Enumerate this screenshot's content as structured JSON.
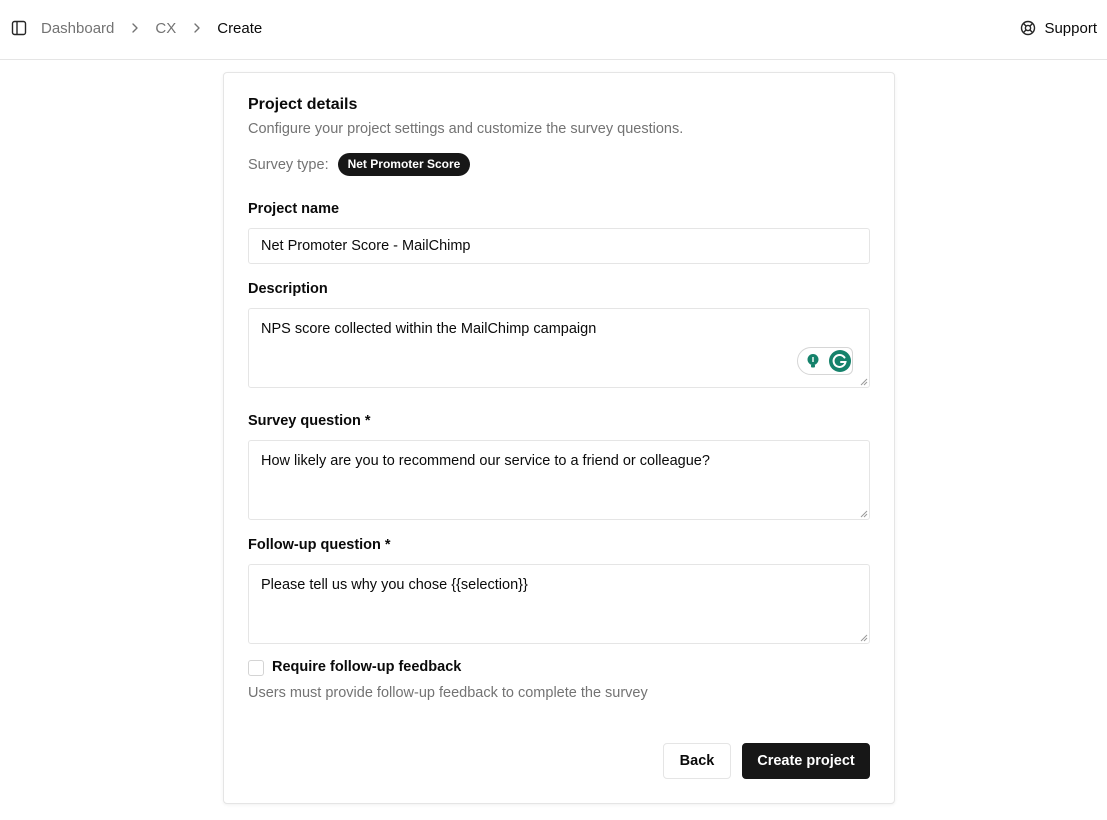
{
  "header": {
    "sidebar_toggle_icon": "panel-left-icon",
    "breadcrumb": [
      "Dashboard",
      "CX",
      "Create"
    ],
    "support_label": "Support",
    "support_icon": "life-buoy-icon"
  },
  "card": {
    "title": "Project details",
    "description": "Configure your project settings and customize the survey questions.",
    "survey_type_label": "Survey type:",
    "survey_type_value": "Net Promoter Score",
    "project_name": {
      "label": "Project name",
      "value": "Net Promoter Score - MailChimp"
    },
    "description_field": {
      "label": "Description",
      "value": "NPS score collected within the MailChimp campaign"
    },
    "survey_question": {
      "label": "Survey question *",
      "value": "How likely are you to recommend our service to a friend or colleague?"
    },
    "followup_question": {
      "label": "Follow-up question *",
      "value": "Please tell us why you chose {{selection}}"
    },
    "require_followup": {
      "label": "Require follow-up feedback",
      "checked": false,
      "help": "Users must provide follow-up feedback to complete the survey"
    },
    "buttons": {
      "back": "Back",
      "create": "Create project"
    }
  },
  "colors": {
    "primary": "#171717",
    "muted_text": "#737373",
    "border": "#e5e5e5",
    "grammarly_green": "#15826b"
  }
}
